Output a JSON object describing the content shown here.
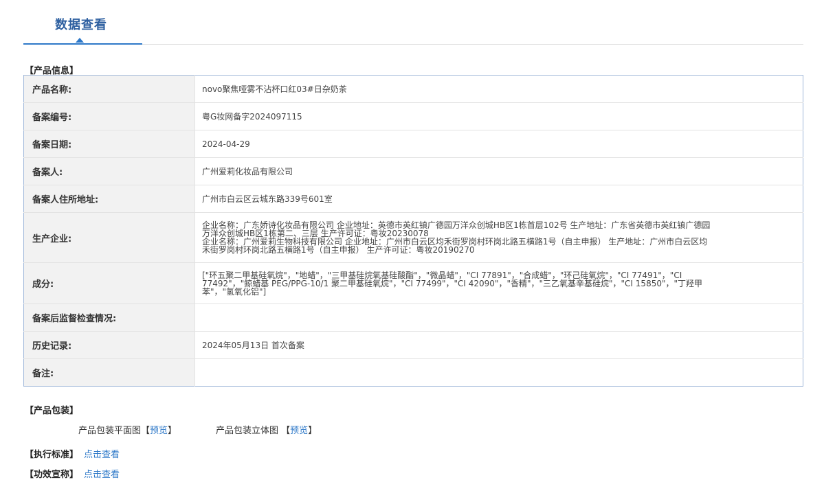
{
  "tab": {
    "label": "数据查看"
  },
  "section_product_info": "【产品信息】",
  "rows": [
    {
      "label": "产品名称:",
      "lines": [
        "novo聚焦哑雾不沾杯口红03#日杂奶茶"
      ]
    },
    {
      "label": "备案编号:",
      "lines": [
        "粤G妆网备字2024097115"
      ]
    },
    {
      "label": "备案日期:",
      "lines": [
        "2024-04-29"
      ]
    },
    {
      "label": "备案人:",
      "lines": [
        "广州爱莉化妆品有限公司"
      ]
    },
    {
      "label": "备案人住所地址:",
      "lines": [
        "广州市白云区云城东路339号601室"
      ]
    },
    {
      "label": "生产企业:",
      "lines": [
        "企业名称：广东娇诗化妆品有限公司 企业地址：英德市英红镇广德园万洋众创城HB区1栋首层102号 生产地址：广东省英德市英红镇广德园",
        "万洋众创城HB区1栋第二、三层 生产许可证：粤妆20230078",
        "企业名称：广州爱莉生物科技有限公司 企业地址：广州市白云区均禾街罗岗村环岗北路五横路1号（自主申报） 生产地址：广州市白云区均",
        "禾街罗岗村环岗北路五横路1号（自主申报） 生产许可证：粤妆20190270"
      ]
    },
    {
      "label": "成分:",
      "lines": [
        "[\"环五聚二甲基硅氧烷\"，\"地蜡\"，\"三甲基硅烷氧基硅酸酯\"，\"微晶蜡\"，\"CI 77891\"，\"合成蜡\"，\"环己硅氧烷\"，\"CI 77491\"，\"CI",
        "77492\"，\"鲸蜡基 PEG/PPG-10/1 聚二甲基硅氧烷\"，\"CI 77499\"，\"CI 42090\"，\"香精\"，\"三乙氧基辛基硅烷\"，\"CI 15850\"，\"丁羟甲",
        "苯\"，\"氢氧化铝\"]"
      ]
    },
    {
      "label": "备案后监督检查情况:",
      "lines": []
    },
    {
      "label": "历史记录:",
      "lines": [
        "2024年05月13日 首次备案"
      ]
    },
    {
      "label": "备注:",
      "lines": []
    }
  ],
  "section_packaging": "【产品包装】",
  "packaging": {
    "flat_label": "产品包装平面图",
    "solid_label": "产品包装立体图",
    "bracket_open": "【",
    "bracket_close": "】",
    "preview_link": "预览"
  },
  "standard": {
    "tag": "【执行标准】",
    "link": "点击查看"
  },
  "efficacy": {
    "tag": "【功效宣称】",
    "link": "点击查看"
  }
}
